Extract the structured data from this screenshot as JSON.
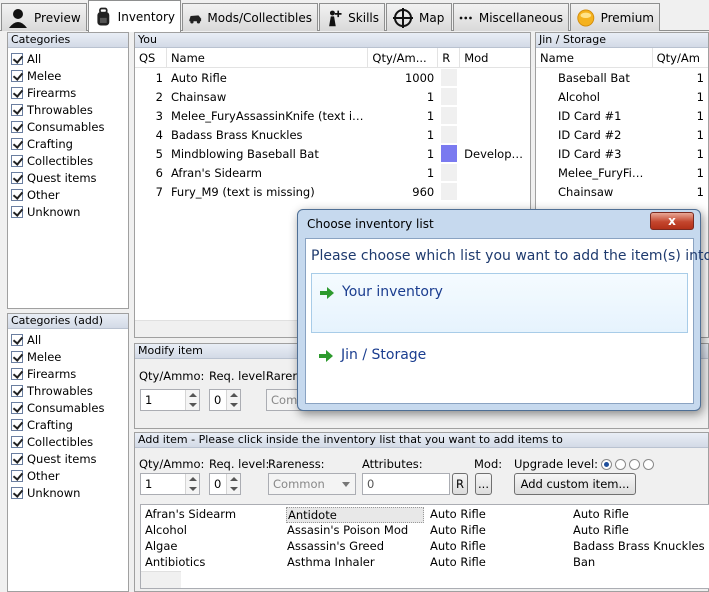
{
  "tabs": [
    {
      "label": "Preview",
      "icon": "person-icon"
    },
    {
      "label": "Inventory",
      "icon": "backpack-icon",
      "active": true
    },
    {
      "label": "Mods/Collectibles",
      "icon": "car-icon"
    },
    {
      "label": "Skills",
      "icon": "skill-person-icon"
    },
    {
      "label": "Map",
      "icon": "crosshair-icon"
    },
    {
      "label": "Miscellaneous",
      "icon": "dots-icon"
    },
    {
      "label": "Premium",
      "icon": "coin-icon"
    }
  ],
  "categories": {
    "title": "Categories",
    "items": [
      "All",
      "Melee",
      "Firearms",
      "Throwables",
      "Consumables",
      "Crafting",
      "Collectibles",
      "Quest items",
      "Other",
      "Unknown"
    ]
  },
  "categories_add": {
    "title": "Categories (add)",
    "items": [
      "All",
      "Melee",
      "Firearms",
      "Throwables",
      "Consumables",
      "Crafting",
      "Collectibles",
      "Quest items",
      "Other",
      "Unknown"
    ]
  },
  "you": {
    "title": "You",
    "headers": {
      "qs": "QS",
      "name": "Name",
      "qty": "Qty/Am...",
      "r": "R",
      "mod": "Mod"
    },
    "rows": [
      {
        "qs": "1",
        "name": "Auto Rifle",
        "qty": "1000",
        "mod": ""
      },
      {
        "qs": "2",
        "name": "Chainsaw",
        "qty": "1",
        "mod": ""
      },
      {
        "qs": "3",
        "name": "Melee_FuryAssassinKnife (text is ...",
        "qty": "1",
        "mod": ""
      },
      {
        "qs": "4",
        "name": "Badass Brass Knuckles",
        "qty": "1",
        "mod": ""
      },
      {
        "qs": "5",
        "name": "Mindblowing Baseball Bat",
        "qty": "1",
        "mod": "Developer's m",
        "rare_color": "#7a7af0"
      },
      {
        "qs": "6",
        "name": "Afran's Sidearm",
        "qty": "1",
        "mod": ""
      },
      {
        "qs": "7",
        "name": "Fury_M9 (text is missing)",
        "qty": "960",
        "mod": ""
      }
    ]
  },
  "storage": {
    "title": "Jin / Storage",
    "headers": {
      "name": "Name",
      "qty": "Qty/Am"
    },
    "rows": [
      {
        "name": "Baseball Bat",
        "qty": "1"
      },
      {
        "name": "Alcohol",
        "qty": "1"
      },
      {
        "name": "ID Card #1",
        "qty": "1"
      },
      {
        "name": "ID Card #2",
        "qty": "1"
      },
      {
        "name": "ID Card #3",
        "qty": "1"
      },
      {
        "name": "Melee_FuryFis...",
        "qty": "1"
      },
      {
        "name": "Chainsaw",
        "qty": "1"
      }
    ]
  },
  "modify": {
    "title": "Modify item",
    "qty_label": "Qty/Ammo:",
    "req_label": "Req. level:",
    "rare_label": "Rarene",
    "qty_value": "1",
    "req_value": "0",
    "rare_value": "Com"
  },
  "add": {
    "title": "Add item - Please click inside the inventory list that you want to add items to",
    "qty_label": "Qty/Ammo:",
    "req_label": "Req. level:",
    "rare_label": "Rareness:",
    "attr_label": "Attributes:",
    "mod_label": "Mod:",
    "upgrade_label": "Upgrade level:",
    "qty_value": "1",
    "req_value": "0",
    "rare_value": "Common",
    "attr_value": "0",
    "r_button": "R",
    "mod_button": "...",
    "custom_button": "Add custom item...",
    "items": [
      [
        "Afran's Sidearm",
        "Antidote",
        "Auto Rifle",
        "Auto Rifle"
      ],
      [
        "Alcohol",
        "Assasin's Poison Mod",
        "Auto Rifle",
        "Auto Rifle"
      ],
      [
        "Algae",
        "Assassin's Greed",
        "Auto Rifle",
        "Badass Brass Knuckles"
      ],
      [
        "Antibiotics",
        "Asthma Inhaler",
        "Auto Rifle",
        "Ban"
      ]
    ]
  },
  "dialog": {
    "title": "Choose inventory list",
    "close": "x",
    "prompt": "Please choose which list you want to add the item(s) into.",
    "choice1": "Your inventory",
    "choice2": "Jin / Storage"
  },
  "colors": {
    "accent": "#1a3d8f",
    "selected_rare": "#7a7af0"
  }
}
